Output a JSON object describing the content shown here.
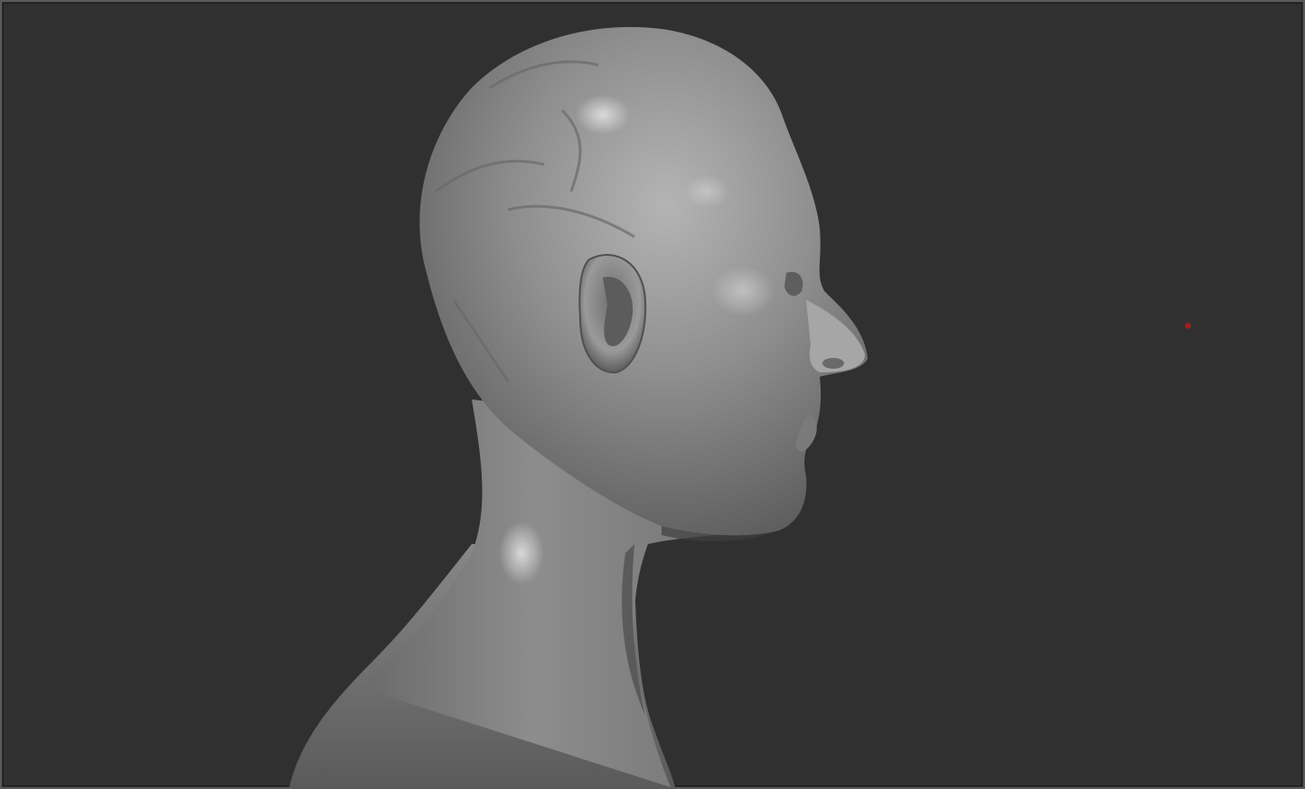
{
  "viewport": {
    "background_color": "#303030",
    "border_color": "#5a5a5a"
  },
  "model": {
    "icon": "sculpted-head-bust-icon",
    "material_color": "#9a9a9a"
  },
  "pivot_marker": {
    "icon": "pivot-point-icon",
    "color": "#b01818"
  }
}
